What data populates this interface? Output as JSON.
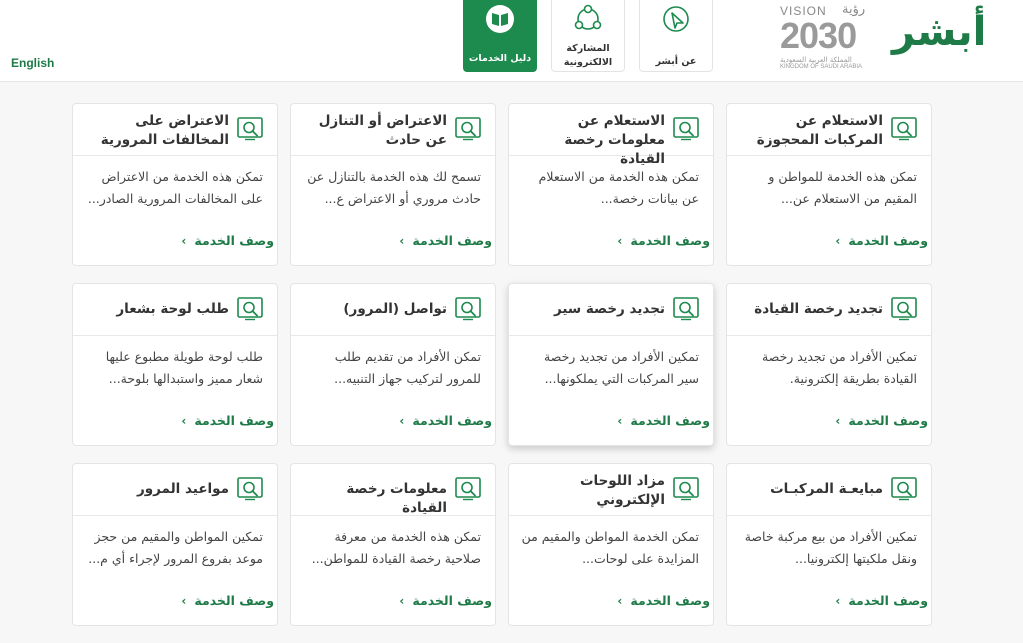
{
  "header": {
    "language_link": "English",
    "logo": {
      "vision": "VISION",
      "vision_ar": "رؤية",
      "year": "2030",
      "kingdom_ar": "المملكة العربية السعودية",
      "kingdom_en": "KINGDOM OF SAUDI ARABIA",
      "brand": "أبشر"
    },
    "nav": [
      {
        "label": "عن أبشر",
        "icon": "pointer-icon",
        "active": false
      },
      {
        "label": "المشاركة الالكترونية",
        "icon": "share-icon",
        "active": false
      },
      {
        "label": "دليل الخدمات",
        "icon": "book-icon",
        "active": true
      }
    ]
  },
  "colors": {
    "brand_green": "#1d8a4e",
    "link_green": "#1e7a46",
    "card_border": "#e4e4e4"
  },
  "link_label": "وصف الخدمة",
  "cards": [
    {
      "title": "الاستعلام عن المركبات المحجوزة",
      "desc": "تمكن هذه الخدمة للمواطن و المقيم من الاستعلام عن...",
      "icon": "search-doc-icon"
    },
    {
      "title": "الاستعلام عن معلومات رخصة القيادة",
      "desc": "تمكن هذه الخدمة من الاستعلام عن بيانات رخصة...",
      "icon": "search-doc-icon"
    },
    {
      "title": "الاعتراض أو التنازل عن حادث",
      "desc": "تسمح لك هذه الخدمة بالتنازل عن حادث مروري أو الاعتراض ع...",
      "icon": "search-doc-icon"
    },
    {
      "title": "الاعتراض على المخالفات المرورية",
      "desc": "تمكن هذه الخدمة من الاعتراض على المخالفات المرورية الصادر...",
      "icon": "search-doc-icon"
    },
    {
      "title": "تجديد رخصة القيادة",
      "desc": "تمكين الأفراد من تجديد رخصة القيادة بطريقة إلكترونية.",
      "icon": "search-doc-icon"
    },
    {
      "title": "تجديد رخصة سير",
      "desc": "تمكين الأفراد من تجديد رخصة سير المركبات التي يملكونها...",
      "icon": "search-doc-icon"
    },
    {
      "title": "تواصل (المرور)",
      "desc": "تمكن الأفراد من تقديم طلب للمرور لتركيب جهاز التنبيه...",
      "icon": "search-doc-icon"
    },
    {
      "title": "طلب لوحة بشعار",
      "desc": "طلب لوحة طويلة مطبوع عليها شعار مميز واستبدالها بلوحة...",
      "icon": "search-doc-icon"
    },
    {
      "title": "مبايعـة المركبـات",
      "desc": "تمكين الأفراد من بيع مركبة خاصة ونقل ملكيتها إلكترونيا...",
      "icon": "search-doc-icon"
    },
    {
      "title": "مزاد اللوحات الإلكتروني",
      "desc": "تمكن الخدمة المواطن والمقيم من المزايدة على لوحات...",
      "icon": "search-doc-icon"
    },
    {
      "title": "معلومات رخصة القيادة",
      "desc": "تمكن هذه الخدمة من معرفة صلاحية رخصة القيادة للمواطن...",
      "icon": "search-doc-icon"
    },
    {
      "title": "مواعيد المرور",
      "desc": "تمكين المواطن والمقيم من حجز موعد بفروع المرور لإجراء أي م...",
      "icon": "search-doc-icon"
    }
  ]
}
